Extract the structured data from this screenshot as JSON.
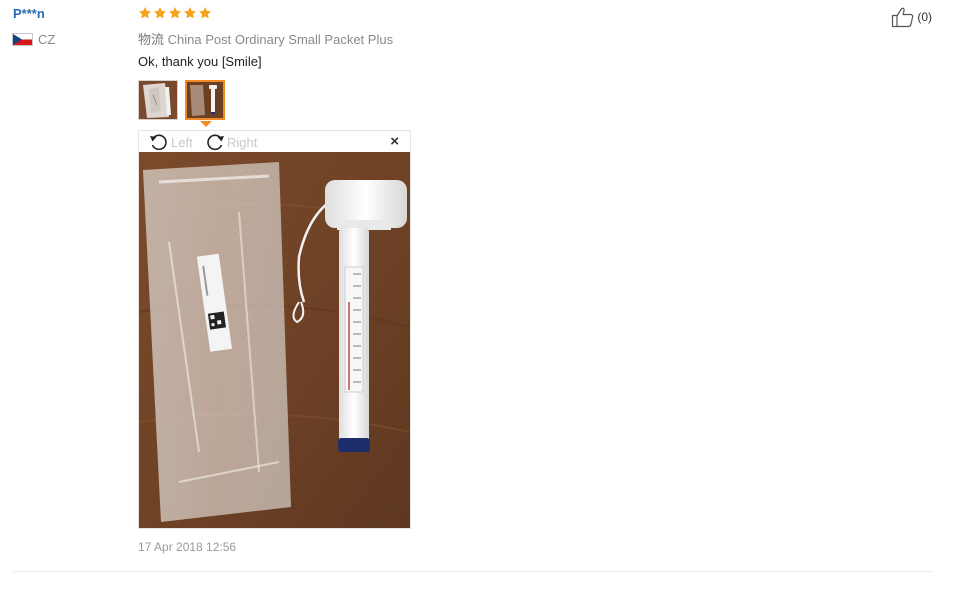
{
  "review": {
    "username": "P***n",
    "country_code": "CZ",
    "rating": 5,
    "shipping_label": "物流",
    "shipping_method": "China Post Ordinary Small Packet Plus",
    "text": "Ok, thank you [Smile]",
    "helpful_count": "(0)",
    "date": "17 Apr 2018 12:56"
  },
  "viewer": {
    "rotate_left_label": "Left",
    "rotate_right_label": "Right",
    "close_icon": "×"
  },
  "colors": {
    "star": "#f7a21b",
    "username": "#2a6cb4",
    "selected_thumb_border": "#f08a24"
  }
}
